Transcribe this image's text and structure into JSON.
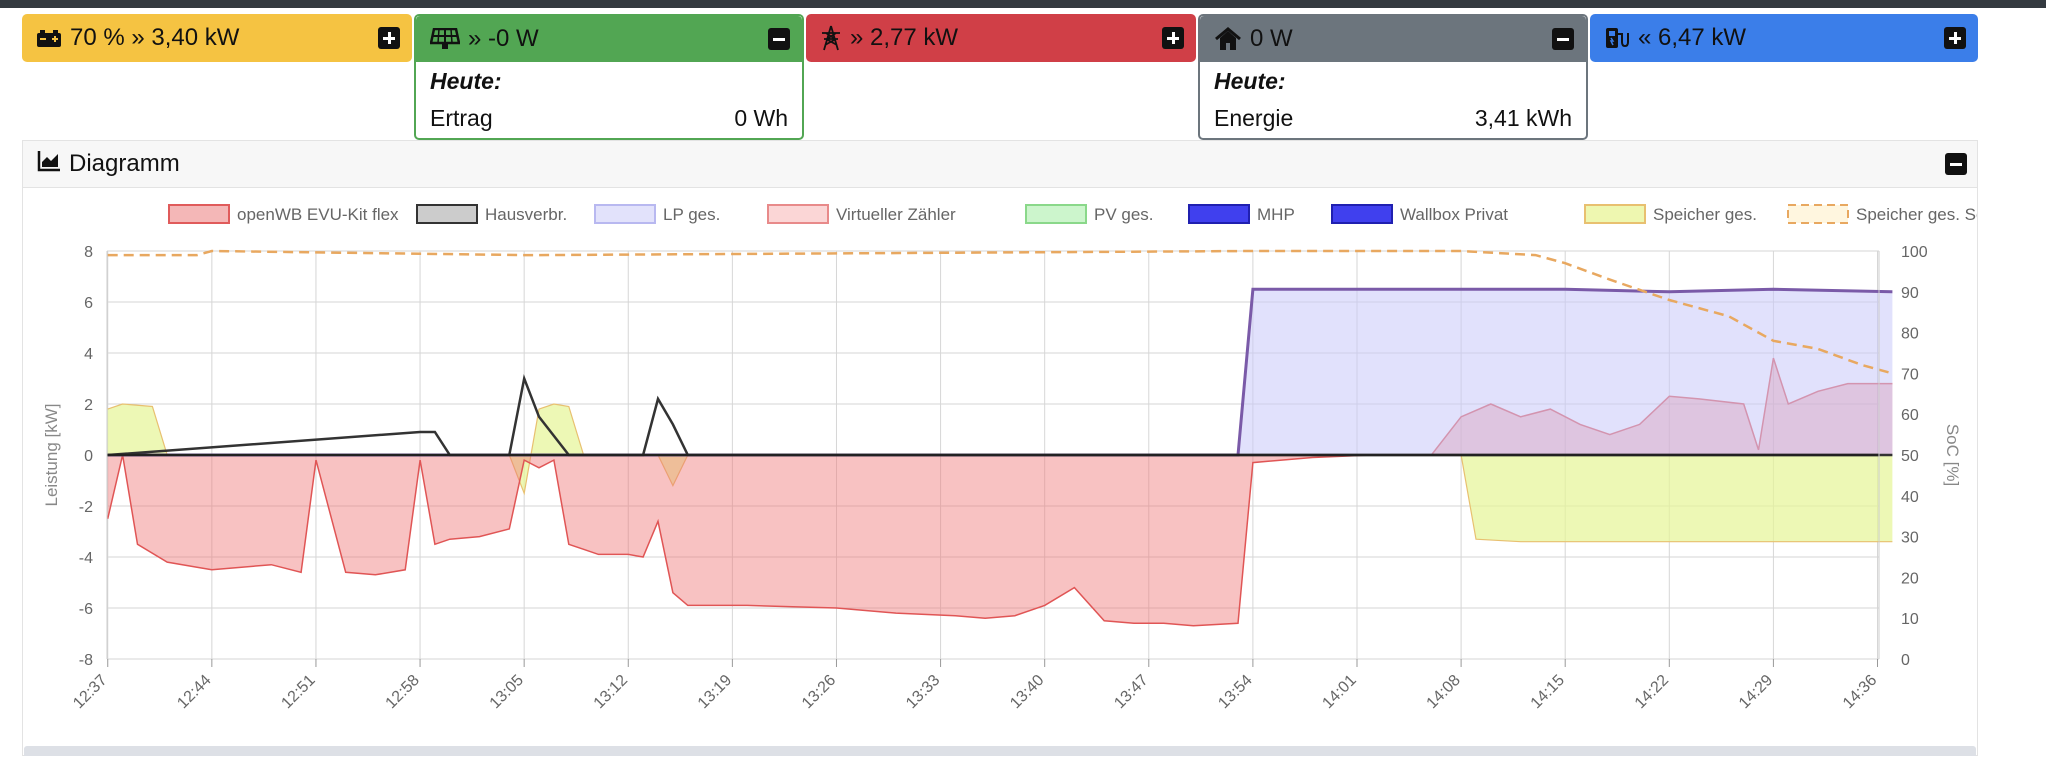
{
  "cards": {
    "battery": {
      "text": "70 % » 3,40 kW",
      "color": "#f5c342"
    },
    "pv": {
      "text": "» -0 W",
      "color": "#52a653",
      "heading": "Heute:",
      "label": "Ertrag",
      "value": "0 Wh"
    },
    "grid": {
      "text": "» 2,77 kW",
      "color": "#d03f47"
    },
    "house": {
      "text": "0 W",
      "color": "#6c757d",
      "heading": "Heute:",
      "label": "Energie",
      "value": "3,41 kWh"
    },
    "charge": {
      "text": "« 6,47 kW",
      "color": "#3b7ee9"
    }
  },
  "panel": {
    "title": "Diagramm"
  },
  "chart_data": {
    "type": "area",
    "title": "",
    "ylabel": "Leistung [kW]",
    "y2label": "SoC [%]",
    "ylim": [
      -8,
      8
    ],
    "y2lim": [
      0,
      100
    ],
    "yticks": [
      "8",
      "6",
      "4",
      "2",
      "0",
      "-2",
      "-4",
      "-6",
      "-8"
    ],
    "y2ticks": [
      "100",
      "90",
      "80",
      "70",
      "60",
      "50",
      "40",
      "30",
      "20",
      "10",
      "0"
    ],
    "xticks": [
      "12:37",
      "12:44",
      "12:51",
      "12:58",
      "13:05",
      "13:12",
      "13:19",
      "13:26",
      "13:33",
      "13:40",
      "13:47",
      "13:54",
      "14:01",
      "14:08",
      "14:15",
      "14:22",
      "14:29",
      "14:36"
    ],
    "grid": true,
    "legend_position": "top",
    "legend": [
      {
        "name": "openWB EVU-Kit flex",
        "fill": "#f4b7b7",
        "stroke": "#e05b5b"
      },
      {
        "name": "Hausverbr.",
        "fill": "#cccccc",
        "stroke": "#333333"
      },
      {
        "name": "LP ges.",
        "fill": "#e2e2fb",
        "stroke": "#b8b8f0"
      },
      {
        "name": "Virtueller Zähler",
        "fill": "#fbd6d6",
        "stroke": "#e88a8a"
      },
      {
        "name": "PV ges.",
        "fill": "#ccf5cc",
        "stroke": "#8ad88a"
      },
      {
        "name": "MHP",
        "fill": "#4040ee",
        "stroke": "#2020b0"
      },
      {
        "name": "Wallbox Privat",
        "fill": "#4040ee",
        "stroke": "#2020b0"
      },
      {
        "name": "Speicher ges.",
        "fill": "#eef7b0",
        "stroke": "#e8c070"
      },
      {
        "name": "Speicher ges. SoC",
        "fill": "#fff6df",
        "stroke": "#e8a860",
        "dashed": true
      }
    ],
    "series": [
      {
        "name": "openWB EVU-Kit flex",
        "x": [
          "12:37",
          "12:38",
          "12:39",
          "12:41",
          "12:43",
          "12:44",
          "12:46",
          "12:48",
          "12:50",
          "12:51",
          "12:53",
          "12:55",
          "12:57",
          "12:58",
          "12:59",
          "13:00",
          "13:02",
          "13:04",
          "13:05",
          "13:06",
          "13:07",
          "13:08",
          "13:09",
          "13:10",
          "13:12",
          "13:13",
          "13:14",
          "13:15",
          "13:16",
          "13:18",
          "13:20",
          "13:26",
          "13:30",
          "13:34",
          "13:36",
          "13:38",
          "13:40",
          "13:42",
          "13:44",
          "13:46",
          "13:48",
          "13:50",
          "13:53",
          "13:54",
          "13:58",
          "14:02",
          "14:06",
          "14:08",
          "14:10",
          "14:12",
          "14:14",
          "14:16",
          "14:18",
          "14:20",
          "14:22",
          "14:24",
          "14:27",
          "14:28",
          "14:29",
          "14:30",
          "14:32",
          "14:34",
          "14:37"
        ],
        "y": [
          -2.5,
          0,
          -3.5,
          -4.2,
          -4.4,
          -4.5,
          -4.4,
          -4.3,
          -4.6,
          -0.2,
          -4.6,
          -4.7,
          -4.5,
          -0.2,
          -3.5,
          -3.3,
          -3.2,
          -2.9,
          -0.2,
          -0.5,
          -0.2,
          -3.5,
          -3.7,
          -3.9,
          -3.9,
          -4.0,
          -2.6,
          -5.4,
          -5.9,
          -5.9,
          -5.9,
          -6.0,
          -6.2,
          -6.3,
          -6.4,
          -6.3,
          -5.9,
          -5.2,
          -6.5,
          -6.6,
          -6.6,
          -6.7,
          -6.6,
          -0.3,
          -0.1,
          0,
          0,
          1.5,
          2.0,
          1.5,
          1.8,
          1.2,
          0.8,
          1.2,
          2.3,
          2.2,
          2.0,
          0.2,
          3.8,
          2.0,
          2.5,
          2.8,
          2.8
        ]
      },
      {
        "name": "Hausverbr.",
        "x": [
          "12:37",
          "12:58",
          "12:59",
          "13:00",
          "13:04",
          "13:05",
          "13:06",
          "13:08",
          "13:13",
          "13:14",
          "13:15",
          "13:16",
          "14:37"
        ],
        "y": [
          0,
          0.9,
          0.9,
          0,
          0,
          3.0,
          1.5,
          0,
          0,
          2.2,
          1.2,
          0,
          0
        ]
      },
      {
        "name": "LP ges.",
        "x": [
          "12:37",
          "13:53",
          "13:54",
          "14:01",
          "14:08",
          "14:15",
          "14:22",
          "14:29",
          "14:37"
        ],
        "y": [
          0,
          0,
          6.5,
          6.5,
          6.5,
          6.5,
          6.4,
          6.5,
          6.4
        ]
      },
      {
        "name": "Speicher ges.",
        "x": [
          "12:37",
          "12:38",
          "12:40",
          "12:41",
          "13:04",
          "13:05",
          "13:06",
          "13:07",
          "13:08",
          "13:09",
          "13:14",
          "13:15",
          "13:16",
          "14:08",
          "14:09",
          "14:12",
          "14:15",
          "14:18",
          "14:20",
          "14:22",
          "14:28",
          "14:29",
          "14:37"
        ],
        "y": [
          1.8,
          2.0,
          1.9,
          0,
          0,
          -1.5,
          1.8,
          2.0,
          1.9,
          0,
          0,
          -1.2,
          0,
          0,
          -3.3,
          -3.4,
          -3.4,
          -3.4,
          -3.4,
          -3.4,
          -3.4,
          -3.4,
          -3.4
        ]
      },
      {
        "name": "Speicher ges. SoC",
        "x": [
          "12:37",
          "12:43",
          "12:44",
          "13:05",
          "13:06",
          "13:54",
          "14:01",
          "14:08",
          "14:13",
          "14:15",
          "14:18",
          "14:22",
          "14:26",
          "14:29",
          "14:32",
          "14:35",
          "14:37"
        ],
        "y": [
          99,
          99,
          100,
          99,
          99,
          100,
          100,
          100,
          99,
          97,
          93,
          88,
          84,
          78,
          76,
          72,
          70
        ]
      }
    ]
  }
}
